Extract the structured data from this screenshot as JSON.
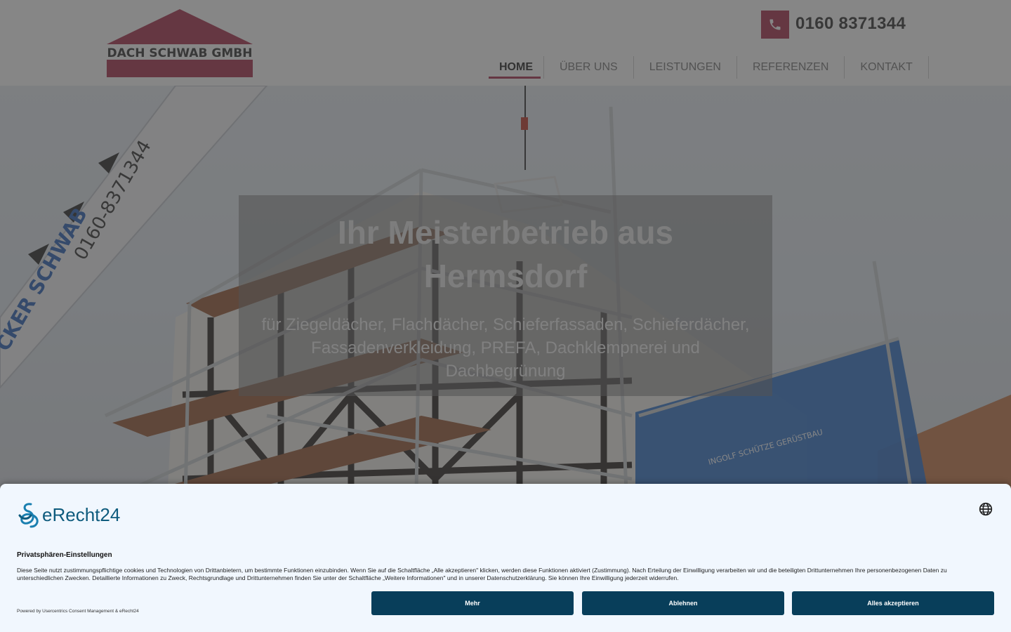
{
  "header": {
    "logo_text": "DACH SCHWAB GMBH",
    "phone": "0160 8371344",
    "phone_icon": "phone-icon",
    "nav": [
      {
        "label": "HOME",
        "active": true
      },
      {
        "label": "ÜBER UNS",
        "active": false
      },
      {
        "label": "LEISTUNGEN",
        "active": false
      },
      {
        "label": "REFERENZEN",
        "active": false
      },
      {
        "label": "KONTAKT",
        "active": false
      }
    ],
    "accent_color": "#a8304e"
  },
  "hero": {
    "title": "Ihr Meisterbetrieb aus Hermsdorf",
    "subtitle": "für Ziegeldächer, Flachdächer, Schieferfassaden, Schieferdächer, Fassadenverkleidung, PREFA, Dachklempnerei und Dachbegrünung",
    "image_texts": {
      "crane_phone": "0160-8371344",
      "crane_name": "CKER SCHWAB",
      "scaffold_brand": "INGOLF SCHÜTZE GERÜSTBAU"
    }
  },
  "consent": {
    "brand": "eRecht24",
    "title": "Privatsphären-Einstellungen",
    "text": "Diese Seite nutzt zustimmungspflichtige cookies und Technologien von Drittanbietern, um bestimmte Funktionen einzubinden. Wenn Sie auf die Schaltfläche „Alle akzeptieren\" klicken, werden diese Funktionen aktiviert (Zustimmung). Nach Erteilung der Einwilligung verarbeiten wir und die beteiligten Drittunternehmen Ihre personenbezogenen Daten zu unterschiedlichen Zwecken. Detaillierte Informationen zu Zweck, Rechtsgrundlage und Drittunternehmen finden Sie unter der Schaltfläche „Weitere Informationen\" und in unserer Datenschutzerklärung. Sie können Ihre Einwilligung jederzeit widerrufen.",
    "powered": "Powered by Usercentrics Consent Management & eRecht24",
    "buttons": {
      "more": "Mehr",
      "decline": "Ablehnen",
      "accept": "Alles akzeptieren"
    },
    "button_color": "#083e5a",
    "language_icon": "globe-icon"
  }
}
